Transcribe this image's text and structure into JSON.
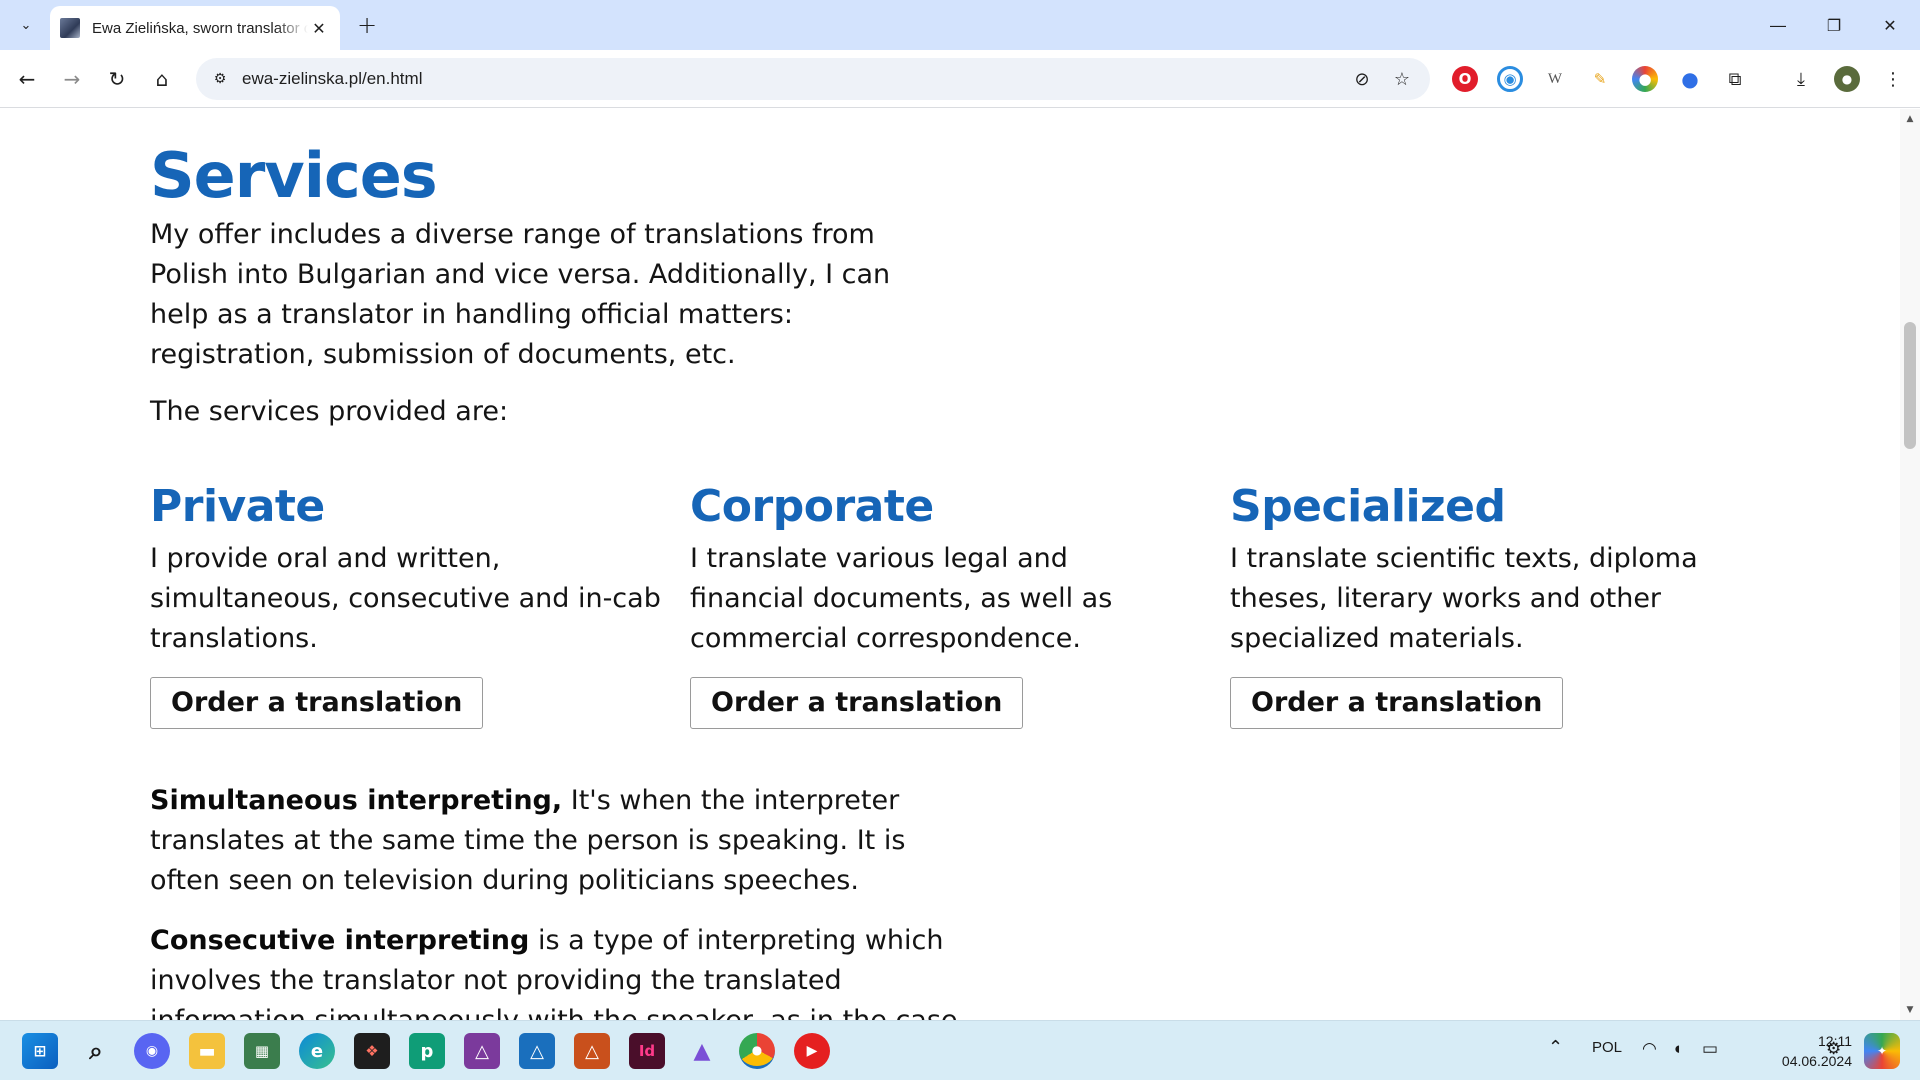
{
  "browser": {
    "tab_title": "Ewa Zielińska, sworn translator of Bulgarian",
    "tab_close": "✕",
    "new_tab": "+",
    "url": "ewa-zielinska.pl/en.html"
  },
  "page": {
    "title": "Services",
    "intro": "My offer includes a diverse range of translations from Polish into Bulgarian and vice versa. Additionally, I can help as a translator in handling official matters: registration, submission of documents, etc.",
    "provided": "The services provided are:",
    "columns": [
      {
        "heading": "Private",
        "text": "I provide oral and written, simultaneous, consecutive and in-cab translations.",
        "button": "Order a translation"
      },
      {
        "heading": "Corporate",
        "text": "I translate various legal and financial documents, as well as commercial correspondence.",
        "button": "Order a translation"
      },
      {
        "heading": "Specialized",
        "text": "I translate scientific texts, diploma theses, literary works and other specialized materials.",
        "button": "Order a translation"
      }
    ],
    "simultaneous": {
      "term": "Simultaneous interpreting,",
      "text": " It's when the interpreter translates at the same time the person is speaking. It is often seen on television during politicians speeches."
    },
    "consecutive": {
      "term": "Consecutive interpreting",
      "text": " is a type of interpreting which involves the translator not providing the translated information simultaneously with the speaker, as in the case of"
    }
  },
  "taskbar": {
    "language": "POL",
    "time": "12:11",
    "date": "04.06.2024"
  },
  "colors": {
    "heading_blue": "#1665b7",
    "tabstrip": "#d3e3fd",
    "taskbar": "#d7ecf6"
  },
  "icons": [
    "tab-search-icon",
    "close-icon",
    "plus-icon",
    "minimize-icon",
    "restore-icon",
    "back-icon",
    "forward-icon",
    "reload-icon",
    "home-icon",
    "site-info-icon",
    "eye-off-icon",
    "star-icon",
    "download-icon",
    "menu-icon",
    "windows-start-icon",
    "search-icon",
    "chrome-icon"
  ]
}
